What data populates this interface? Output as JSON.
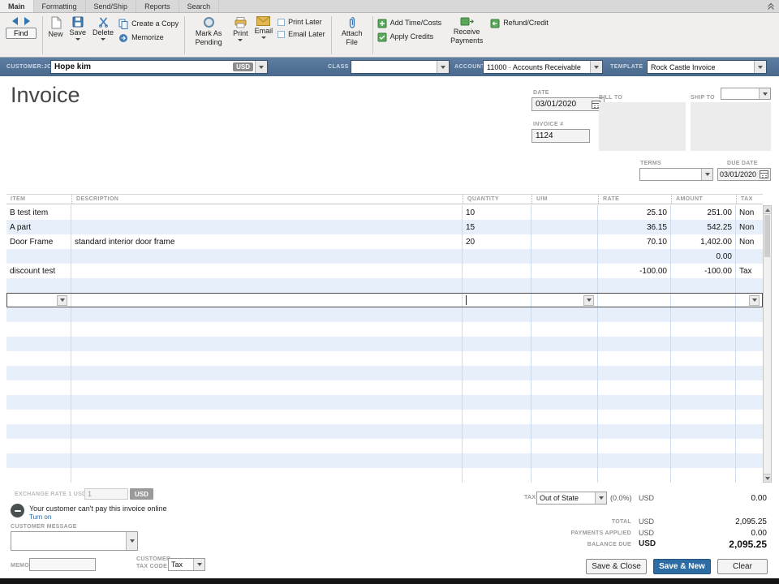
{
  "window": {
    "tabs": [
      {
        "label": "Main",
        "active": true
      },
      {
        "label": "Formatting",
        "active": false
      },
      {
        "label": "Send/Ship",
        "active": false
      },
      {
        "label": "Reports",
        "active": false
      },
      {
        "label": "Search",
        "active": false
      }
    ]
  },
  "toolbar": {
    "find": "Find",
    "new": "New",
    "save": "Save",
    "delete": "Delete",
    "create_a_copy": "Create a Copy",
    "memorize": "Memorize",
    "mark_as_pending": "Mark As Pending",
    "print": "Print",
    "email": "Email",
    "print_later": "Print Later",
    "email_later": "Email Later",
    "attach_file": "Attach File",
    "add_time_costs": "Add Time/Costs",
    "apply_credits": "Apply Credits",
    "receive_payments": "Receive Payments",
    "refund_credit": "Refund/Credit"
  },
  "header_bar": {
    "customer_job_label": "CUSTOMER:JOB",
    "customer_job_value": "Hope kim",
    "currency_badge": "USD",
    "class_label": "CLASS",
    "class_value": "",
    "account_label": "ACCOUNT",
    "account_value": "11000 · Accounts Receivable",
    "template_label": "TEMPLATE",
    "template_value": "Rock Castle Invoice"
  },
  "invoice": {
    "title": "Invoice",
    "date_label": "DATE",
    "date_value": "03/01/2020",
    "invoice_number_label": "INVOICE #",
    "invoice_number_value": "1124",
    "bill_to_label": "BILL TO",
    "bill_to_value": "",
    "ship_to_label": "SHIP TO",
    "ship_to_value": "",
    "terms_label": "TERMS",
    "terms_value": "",
    "due_date_label": "DUE DATE",
    "due_date_value": "03/01/2020"
  },
  "table": {
    "columns": [
      "ITEM",
      "DESCRIPTION",
      "QUANTITY",
      "U/M",
      "RATE",
      "AMOUNT",
      "TAX"
    ],
    "rows": [
      {
        "item": "B test item",
        "description": "",
        "quantity": "10",
        "um": "",
        "rate": "25.10",
        "amount": "251.00",
        "tax": "Non"
      },
      {
        "item": "A part",
        "description": "",
        "quantity": "15",
        "um": "",
        "rate": "36.15",
        "amount": "542.25",
        "tax": "Non"
      },
      {
        "item": "Door Frame",
        "description": "standard interior door frame",
        "quantity": "20",
        "um": "",
        "rate": "70.10",
        "amount": "1,402.00",
        "tax": "Non"
      },
      {
        "item": "",
        "description": "",
        "quantity": "",
        "um": "",
        "rate": "",
        "amount": "0.00",
        "tax": ""
      },
      {
        "item": "discount test",
        "description": "",
        "quantity": "",
        "um": "",
        "rate": "-100.00",
        "amount": "-100.00",
        "tax": "Tax"
      }
    ]
  },
  "footer": {
    "exchange_rate_label": "EXCHANGE RATE 1 USD =",
    "exchange_rate_value": "1",
    "exchange_rate_currency": "USD",
    "online_payment_message": "Your customer can't pay this invoice online",
    "turn_on_link": "Turn on",
    "customer_message_label": "CUSTOMER MESSAGE",
    "customer_message_value": "",
    "memo_label": "MEMO",
    "memo_value": "",
    "customer_tax_code_label": "CUSTOMER TAX CODE",
    "customer_tax_code_value": "Tax",
    "summary": {
      "tax_label": "TAX",
      "tax_selector_value": "Out of State",
      "tax_rate": "(0.0%)",
      "tax_currency": "USD",
      "tax_amount": "0.00",
      "total_label": "TOTAL",
      "total_currency": "USD",
      "total_amount": "2,095.25",
      "payments_applied_label": "PAYMENTS APPLIED",
      "payments_currency": "USD",
      "payments_amount": "0.00",
      "balance_due_label": "BALANCE DUE",
      "balance_currency": "USD",
      "balance_amount": "2,095.25"
    },
    "buttons": {
      "save_close": "Save & Close",
      "save_new": "Save & New",
      "clear": "Clear"
    }
  }
}
